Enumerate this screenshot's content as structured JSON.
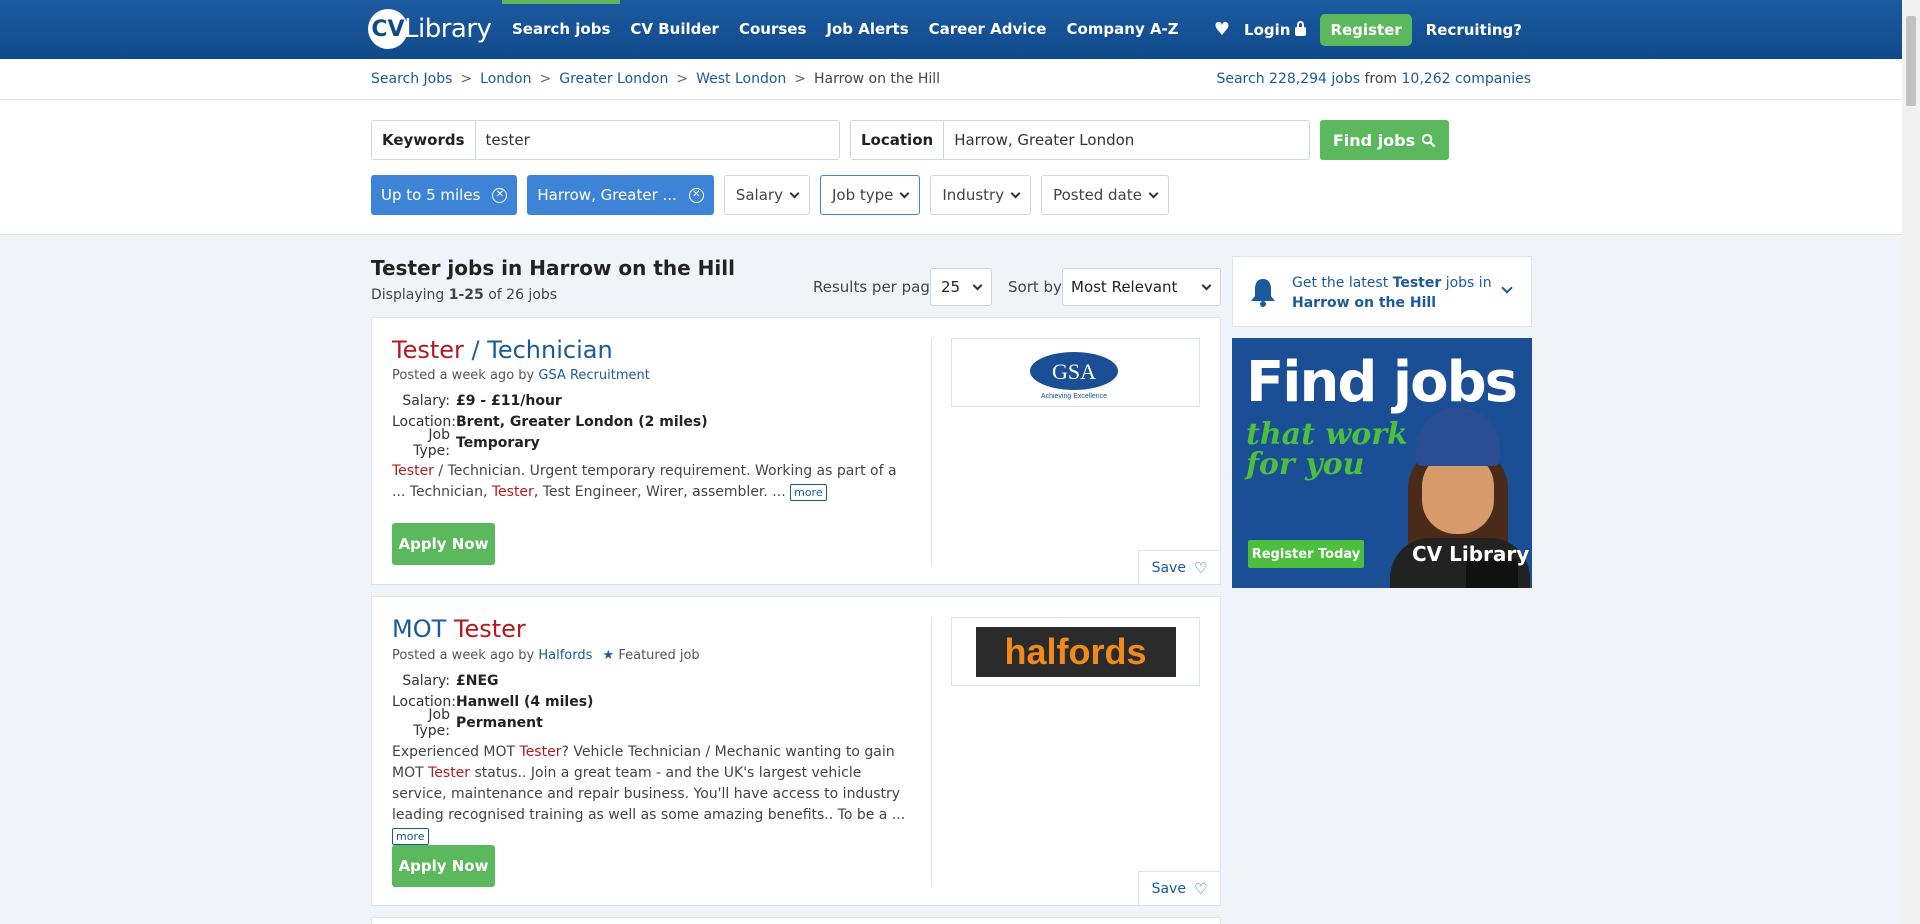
{
  "header": {
    "logo_text": "Library",
    "nav": [
      "Search jobs",
      "CV Builder",
      "Courses",
      "Job Alerts",
      "Career Advice",
      "Company A-Z"
    ],
    "login": "Login",
    "register": "Register",
    "recruiting": "Recruiting?"
  },
  "breadcrumb": {
    "items": [
      "Search Jobs",
      "London",
      "Greater London",
      "West London",
      "Harrow on the Hill"
    ],
    "search_prefix": "Search",
    "jobs_count": "228,294 jobs",
    "from": "from",
    "companies_count": "10,262 companies"
  },
  "search": {
    "keywords_label": "Keywords",
    "keywords_value": "tester",
    "location_label": "Location",
    "location_value": "Harrow, Greater London",
    "find_button": "Find jobs"
  },
  "filters": {
    "chips": [
      "Up to 5 miles",
      "Harrow, Greater ..."
    ],
    "dropdowns": [
      "Salary",
      "Job type",
      "Industry",
      "Posted date"
    ]
  },
  "results": {
    "title": "Tester jobs in Harrow on the Hill",
    "displaying_prefix": "Displaying",
    "displaying_range": "1-25",
    "displaying_suffix": "of 26 jobs",
    "per_page_label": "Results per page:",
    "per_page_value": "25",
    "sort_label": "Sort by:",
    "sort_value": "Most Relevant"
  },
  "jobs": [
    {
      "title_kw": "Tester",
      "title_rest": " / Technician",
      "posted": "Posted a week ago by",
      "company": "GSA Recruitment",
      "salary_key": "Salary:",
      "salary": "£9 - £11/hour",
      "location_key": "Location:",
      "location": "Brent, Greater London (2 miles)",
      "type_key": "Job Type:",
      "type": "Temporary",
      "desc": [
        {
          "t": "Tester",
          "k": true
        },
        {
          "t": " / Technician. Urgent temporary requirement. Working as part of a ... Technician, ",
          "k": false
        },
        {
          "t": "Tester",
          "k": true
        },
        {
          "t": ", Test Engineer, Wirer, assembler. ... ",
          "k": false
        }
      ],
      "more": "more",
      "apply": "Apply Now",
      "save": "Save",
      "logo_main": "GSA",
      "logo_sub": "Achieving Excellence"
    },
    {
      "title_pre": "MOT ",
      "title_kw": "Tester",
      "posted": "Posted a week ago by",
      "company": "Halfords",
      "featured": "Featured job",
      "salary_key": "Salary:",
      "salary": "£NEG",
      "location_key": "Location:",
      "location": "Hanwell (4 miles)",
      "type_key": "Job Type:",
      "type": "Permanent",
      "desc": [
        {
          "t": "Experienced MOT ",
          "k": false
        },
        {
          "t": "Tester",
          "k": true
        },
        {
          "t": "? Vehicle Technician / Mechanic wanting to gain MOT ",
          "k": false
        },
        {
          "t": "Tester",
          "k": true
        },
        {
          "t": " status.. Join a great team - and the UK's largest vehicle service, maintenance and repair business. You'll have access to industry leading recognised training as well as some amazing benefits.. To be a ... ",
          "k": false
        }
      ],
      "more": "more",
      "apply": "Apply Now",
      "save": "Save",
      "logo_main": "halfords"
    }
  ],
  "sidebar": {
    "alert_prefix": "Get the latest",
    "alert_kw": "Tester",
    "alert_mid": "jobs in",
    "alert_loc": "Harrow on the Hill",
    "ad_line1": "Find jobs",
    "ad_line2a": "that work",
    "ad_line2b": "for you",
    "ad_button": "Register Today",
    "ad_logo": "CV Library"
  },
  "colors": {
    "brand_blue": "#0f4a8a",
    "green": "#5cb85c",
    "keyword_red": "#b3191e",
    "chip_blue": "#3d84d6"
  }
}
